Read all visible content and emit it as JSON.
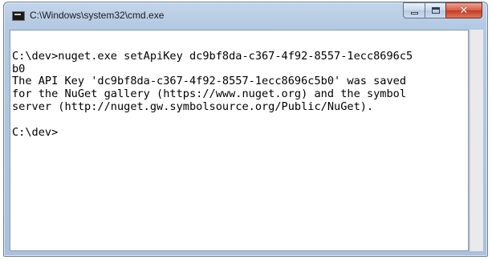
{
  "window": {
    "title": "C:\\Windows\\system32\\cmd.exe",
    "icon": "cmd-console-icon"
  },
  "caption_buttons": {
    "minimize_icon": "minimize-icon",
    "maximize_icon": "maximize-icon",
    "close_glyph": "✕"
  },
  "console": {
    "lines": [
      "",
      "C:\\dev>nuget.exe setApiKey dc9bf8da-c367-4f92-8557-1ecc8696c5",
      "b0",
      "The API Key 'dc9bf8da-c367-4f92-8557-1ecc8696c5b0' was saved",
      "for the NuGet gallery (https://www.nuget.org) and the symbol",
      "server (http://nuget.gw.symbolsource.org/Public/NuGet).",
      "",
      "C:\\dev>"
    ]
  },
  "colors": {
    "titlebar": "#b4c9e2",
    "close_button": "#c23a22",
    "console_background": "#ffffff",
    "console_text": "#000000"
  }
}
